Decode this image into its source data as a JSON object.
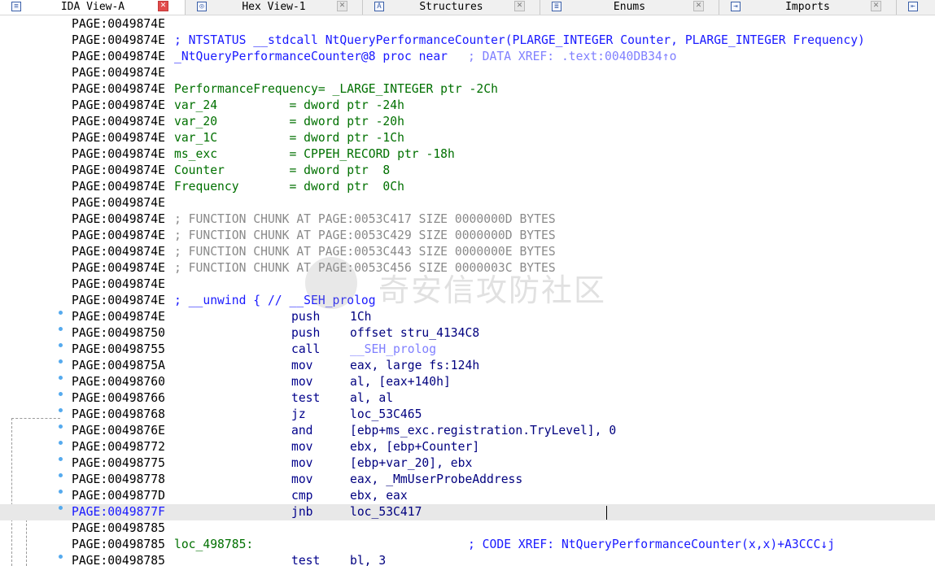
{
  "tabs": [
    {
      "label": "IDA View-A",
      "icon": "disasm-icon",
      "active": true
    },
    {
      "label": "Hex View-1",
      "icon": "hex-icon",
      "active": false
    },
    {
      "label": "Structures",
      "icon": "structures-icon",
      "active": false
    },
    {
      "label": "Enums",
      "icon": "enums-icon",
      "active": false
    },
    {
      "label": "Imports",
      "icon": "imports-icon",
      "active": false
    }
  ],
  "lines": [
    {
      "addr": "PAGE:0049874E",
      "text": ""
    },
    {
      "addr": "PAGE:0049874E",
      "text": "; NTSTATUS __stdcall NtQueryPerformanceCounter(PLARGE_INTEGER Counter, PLARGE_INTEGER Frequency)"
    },
    {
      "addr": "PAGE:0049874E",
      "text": "_NtQueryPerformanceCounter@8 proc near",
      "xref": "; DATA XREF: .text:0040DB34↑o"
    },
    {
      "addr": "PAGE:0049874E",
      "text": ""
    },
    {
      "addr": "PAGE:0049874E",
      "text": "PerformanceFrequency= _LARGE_INTEGER ptr -2Ch"
    },
    {
      "addr": "PAGE:0049874E",
      "text": "var_24          = dword ptr -24h"
    },
    {
      "addr": "PAGE:0049874E",
      "text": "var_20          = dword ptr -20h"
    },
    {
      "addr": "PAGE:0049874E",
      "text": "var_1C          = dword ptr -1Ch"
    },
    {
      "addr": "PAGE:0049874E",
      "text": "ms_exc          = CPPEH_RECORD ptr -18h"
    },
    {
      "addr": "PAGE:0049874E",
      "text": "Counter         = dword ptr  8"
    },
    {
      "addr": "PAGE:0049874E",
      "text": "Frequency       = dword ptr  0Ch"
    },
    {
      "addr": "PAGE:0049874E",
      "text": ""
    },
    {
      "addr": "PAGE:0049874E",
      "text": "; FUNCTION CHUNK AT PAGE:0053C417 SIZE 0000000D BYTES"
    },
    {
      "addr": "PAGE:0049874E",
      "text": "; FUNCTION CHUNK AT PAGE:0053C429 SIZE 0000000D BYTES"
    },
    {
      "addr": "PAGE:0049874E",
      "text": "; FUNCTION CHUNK AT PAGE:0053C443 SIZE 0000000E BYTES"
    },
    {
      "addr": "PAGE:0049874E",
      "text": "; FUNCTION CHUNK AT PAGE:0053C456 SIZE 0000003C BYTES"
    },
    {
      "addr": "PAGE:0049874E",
      "text": ""
    },
    {
      "addr": "PAGE:0049874E",
      "text": "; __unwind { // __SEH_prolog"
    },
    {
      "addr": "PAGE:0049874E",
      "mnem": "push",
      "ops": "1Ch"
    },
    {
      "addr": "PAGE:00498750",
      "mnem": "push",
      "ops": "offset stru_4134C8"
    },
    {
      "addr": "PAGE:00498755",
      "mnem": "call",
      "ops": "__SEH_prolog"
    },
    {
      "addr": "PAGE:0049875A",
      "mnem": "mov",
      "ops": "eax, large fs:124h"
    },
    {
      "addr": "PAGE:00498760",
      "mnem": "mov",
      "ops": "al, [eax+140h]"
    },
    {
      "addr": "PAGE:00498766",
      "mnem": "test",
      "ops": "al, al"
    },
    {
      "addr": "PAGE:00498768",
      "mnem": "jz",
      "ops": "loc_53C465"
    },
    {
      "addr": "PAGE:0049876E",
      "mnem": "and",
      "ops": "[ebp+ms_exc.registration.TryLevel], 0"
    },
    {
      "addr": "PAGE:00498772",
      "mnem": "mov",
      "ops": "ebx, [ebp+Counter]"
    },
    {
      "addr": "PAGE:00498775",
      "mnem": "mov",
      "ops": "[ebp+var_20], ebx"
    },
    {
      "addr": "PAGE:00498778",
      "mnem": "mov",
      "ops": "eax, _MmUserProbeAddress"
    },
    {
      "addr": "PAGE:0049877D",
      "mnem": "cmp",
      "ops": "ebx, eax"
    },
    {
      "addr": "PAGE:0049877F",
      "mnem": "jnb",
      "ops": "loc_53C417"
    },
    {
      "addr": "PAGE:00498785",
      "text": ""
    },
    {
      "addr": "PAGE:00498785",
      "text": "loc_498785:",
      "xref": "; CODE XREF: NtQueryPerformanceCounter(x,x)+A3CCC↓j"
    },
    {
      "addr": "PAGE:00498785",
      "mnem": "test",
      "ops": "bl, 3"
    }
  ],
  "watermark": "奇安信攻防社区"
}
